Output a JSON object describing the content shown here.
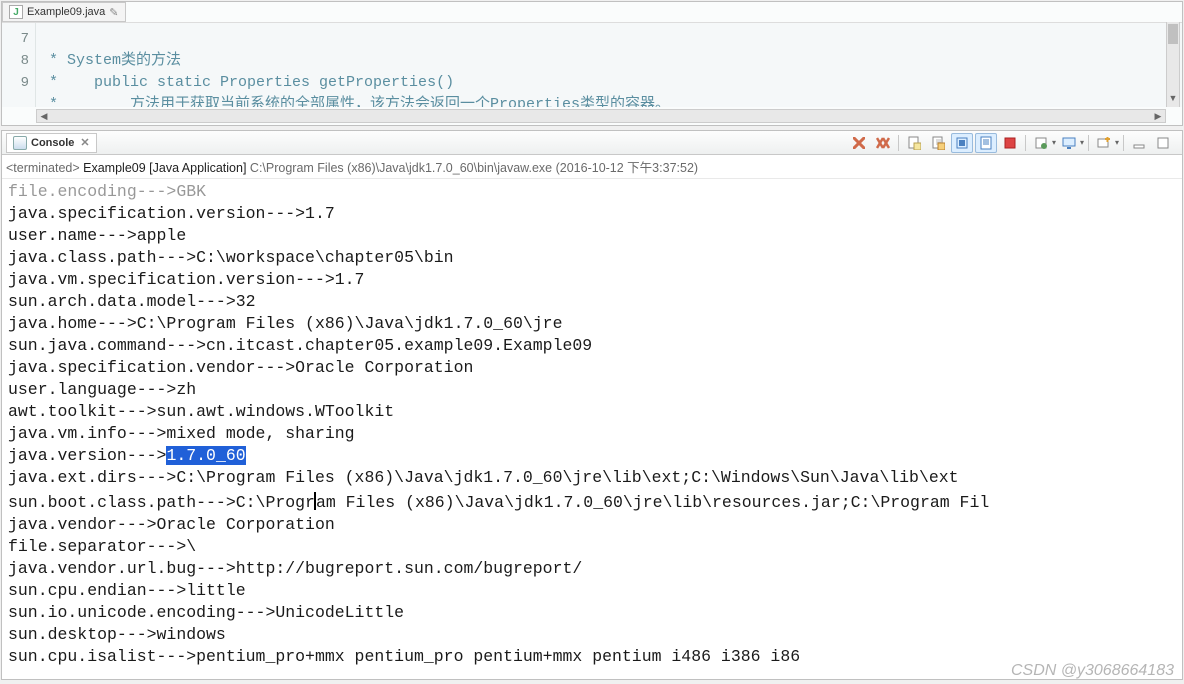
{
  "editor": {
    "tab_filename": "Example09.java",
    "dirty_marker": "✎",
    "lines": {
      "7": " * System类的方法",
      "8": " *    public static Properties getProperties()",
      "9": " *        方法用于获取当前系统的全部属性，该方法会返回一个Properties类型的容器。"
    },
    "gutter": [
      "7",
      "8",
      "9"
    ]
  },
  "console": {
    "tab_label": "Console",
    "termination_prefix": "<terminated> ",
    "run_config": "Example09 [Java Application]",
    "run_path": " C:\\Program Files (x86)\\Java\\jdk1.7.0_60\\bin\\javaw.exe (2016-10-12 下午3:37:52)"
  },
  "output": {
    "lines_before_highlight": [
      "file.encoding--->GBK",
      "java.specification.version--->1.7",
      "user.name--->apple",
      "java.class.path--->C:\\workspace\\chapter05\\bin",
      "java.vm.specification.version--->1.7",
      "sun.arch.data.model--->32",
      "java.home--->C:\\Program Files (x86)\\Java\\jdk1.7.0_60\\jre",
      "sun.java.command--->cn.itcast.chapter05.example09.Example09",
      "java.specification.vendor--->Oracle Corporation",
      "user.language--->zh",
      "awt.toolkit--->sun.awt.windows.WToolkit",
      "java.vm.info--->mixed mode, sharing"
    ],
    "highlight_line_prefix": "java.version--->",
    "highlight_value": "1.7.0_60",
    "lines_after_highlight": [
      "java.ext.dirs--->C:\\Program Files (x86)\\Java\\jdk1.7.0_60\\jre\\lib\\ext;C:\\Windows\\Sun\\Java\\lib\\ext",
      "sun.boot.class.path--->C:\\Program Files (x86)\\Java\\jdk1.7.0_60\\jre\\lib\\resources.jar;C:\\Program Fil",
      "java.vendor--->Oracle Corporation",
      "file.separator--->\\",
      "java.vendor.url.bug--->http://bugreport.sun.com/bugreport/",
      "sun.cpu.endian--->little",
      "sun.io.unicode.encoding--->UnicodeLittle",
      "sun.desktop--->windows",
      "sun.cpu.isalist--->pentium_pro+mmx pentium_pro pentium+mmx pentium i486 i386 i86"
    ]
  },
  "watermark": "CSDN @y3068664183"
}
